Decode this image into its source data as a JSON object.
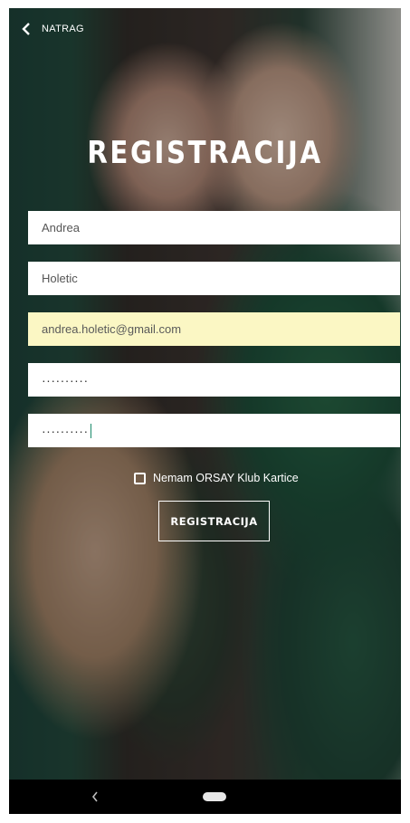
{
  "header": {
    "back_label": "NATRAG",
    "back_icon": "chevron-left-icon"
  },
  "title": "REGISTRACIJA",
  "form": {
    "first_name": "Andrea",
    "last_name": "Holetic",
    "email": "andrea.holetic@gmail.com",
    "password_mask": "··········",
    "confirm_password_mask": "··········",
    "no_card_label": "Nemam ORSAY Klub Kartice",
    "no_card_checked": false,
    "submit_label": "REGISTRACIJA",
    "autofill_color": "#fbf7c4"
  },
  "navbar": {
    "back_icon": "nav-back-icon",
    "home_icon": "nav-home-pill-icon"
  }
}
